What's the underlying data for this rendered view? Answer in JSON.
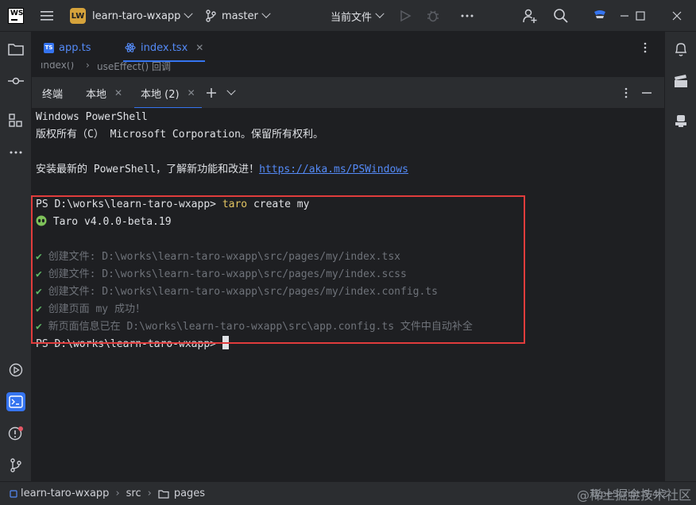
{
  "titlebar": {
    "project_badge": "LW",
    "project_name": "learn-taro-wxapp",
    "branch": "master",
    "run_config": "当前文件"
  },
  "editor_tabs": [
    {
      "label": "app.ts",
      "icon": "ts-file-icon"
    },
    {
      "label": "index.tsx",
      "icon": "react-file-icon"
    }
  ],
  "breadcrumb_strip": {
    "left": "index()",
    "right": "useEffect() 回调"
  },
  "terminal": {
    "title": "终端",
    "tabs": [
      "本地",
      "本地 (2)"
    ],
    "lines": {
      "l1": "Windows PowerShell",
      "l2": "版权所有（C） Microsoft Corporation。保留所有权利。",
      "l3_text": "安装最新的 PowerShell，了解新功能和改进！",
      "l3_link": "https://aka.ms/PSWindows",
      "prompt": "PS D:\\works\\learn-taro-wxapp> ",
      "cmd_word": "taro",
      "cmd_rest": " create my",
      "taro_version": " Taro v4.0.0-beta.19",
      "created1": "创建文件: D:\\works\\learn-taro-wxapp\\src/pages/my/index.tsx",
      "created2": "创建文件: D:\\works\\learn-taro-wxapp\\src/pages/my/index.scss",
      "created3": "创建文件: D:\\works\\learn-taro-wxapp\\src/pages/my/index.config.ts",
      "created4": "创建页面 my 成功！",
      "created5": "新页面信息已在 D:\\works\\learn-taro-wxapp\\src\\app.config.ts 文件中自动补全",
      "prompt2": "PS D:\\works\\learn-taro-wxapp> "
    }
  },
  "statusbar": {
    "project": "learn-taro-wxapp",
    "folder1": "src",
    "folder2": "pages",
    "language": "TypeScript 5.4.2",
    "watermark": "@稀土掘金技术社区"
  },
  "colors": {
    "accent": "#3574f0",
    "highlight_box": "#e03c3c",
    "success": "#5fb865",
    "project_badge": "#d6a33b"
  }
}
